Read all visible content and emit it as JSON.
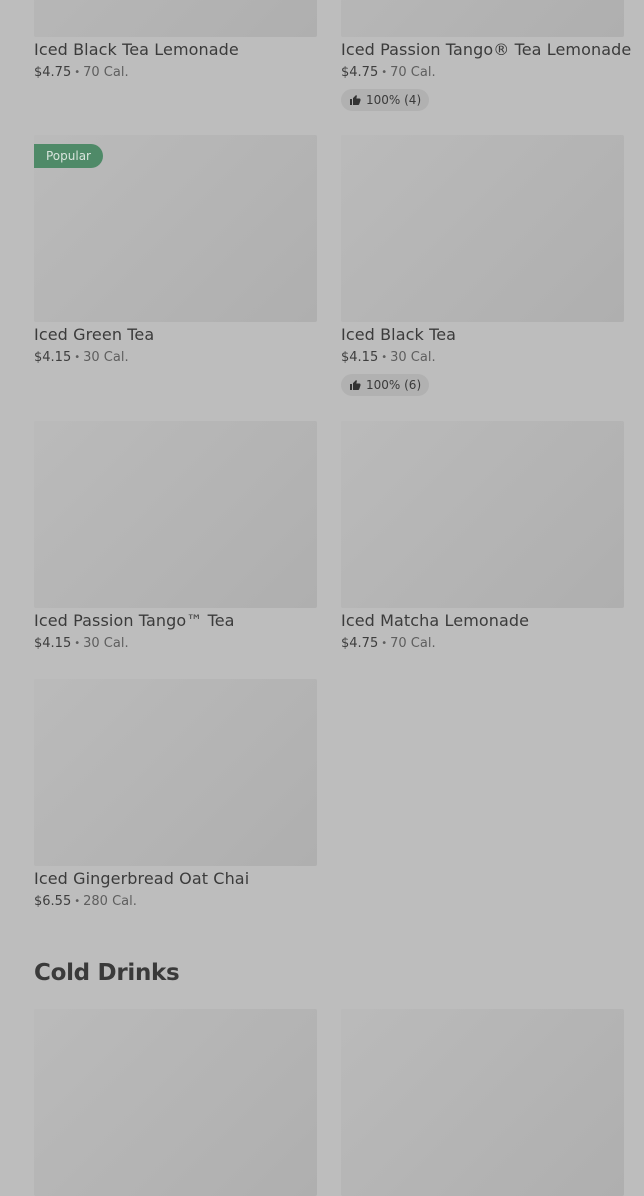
{
  "items": [
    {
      "name": "Iced Black Tea Lemonade",
      "price": "$4.75",
      "cal": "70 Cal."
    },
    {
      "name": "Iced Passion Tango® Tea Lemonade",
      "price": "$4.75",
      "cal": "70 Cal.",
      "rating": "100% (4)"
    },
    {
      "name": "Iced Green Tea",
      "price": "$4.15",
      "cal": "30 Cal.",
      "badge": "Popular"
    },
    {
      "name": "Iced Black Tea",
      "price": "$4.15",
      "cal": "30 Cal.",
      "rating": "100% (6)"
    },
    {
      "name": "Iced Passion Tango™ Tea",
      "price": "$4.15",
      "cal": "30 Cal."
    },
    {
      "name": "Iced Matcha Lemonade",
      "price": "$4.75",
      "cal": "70 Cal."
    },
    {
      "name": "Iced Gingerbread Oat Chai",
      "price": "$6.55",
      "cal": "280 Cal."
    }
  ],
  "sections": {
    "cold_drinks": "Cold Drinks"
  },
  "separator": "•",
  "icons": {
    "rating": "thumbs-up-icon"
  }
}
